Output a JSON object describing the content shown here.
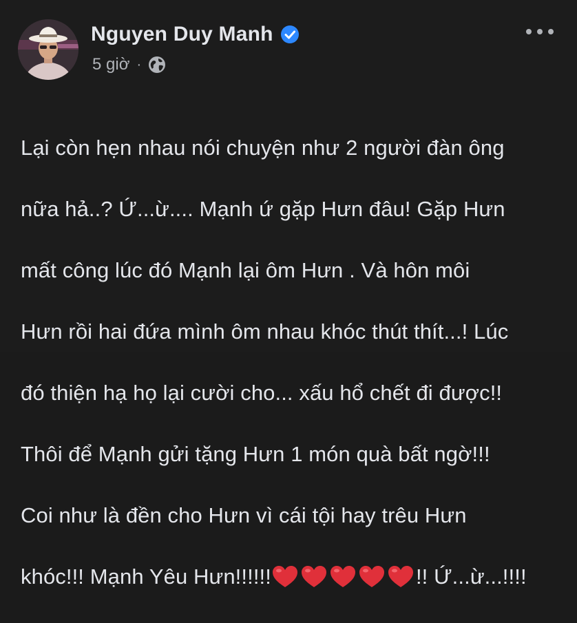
{
  "post": {
    "author": "Nguyen Duy Manh",
    "time": "5 giờ",
    "separator": "·",
    "icons": {
      "verified": "verified-badge-icon",
      "audience": "globe-icon",
      "more": "more-options-icon",
      "emoji": "red-heart-icon"
    },
    "colors": {
      "verified": "#2d88ff",
      "heart": "#e0303a"
    },
    "body_lines": [
      "Lại còn hẹn nhau nói chuyện như 2 người đàn ông",
      "nữa hả..? Ứ...ừ.... Mạnh ứ gặp Hưn đâu! Gặp Hưn",
      "mất công lúc đó Mạnh lại ôm Hưn . Và hôn môi",
      "Hưn rồi hai đứa mình ôm nhau khóc thút thít...! Lúc",
      "đó thiện hạ họ lại cười cho... xấu hổ chết đi được!!",
      "Thôi để Mạnh gửi tặng Hưn 1 món quà bất ngờ!!!",
      "Coi như là đền cho Hưn vì cái tội hay trêu Hưn"
    ],
    "last_line": {
      "before": "khóc!!! Mạnh Yêu Hưn!!!!!!",
      "heart_count": 5,
      "after": "!! Ứ...ừ...!!!!"
    }
  }
}
